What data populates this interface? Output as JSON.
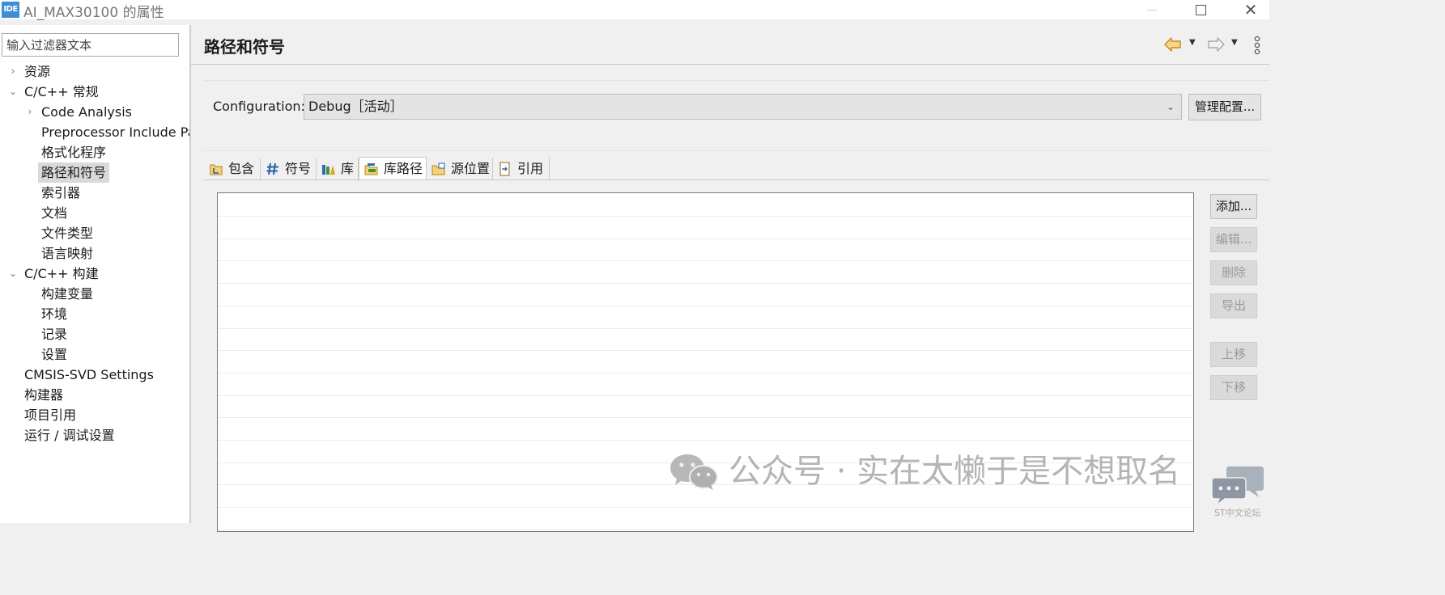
{
  "window": {
    "app_logo": "IDE",
    "title": "AI_MAX30100 的属性",
    "controls": [
      "minimize-icon",
      "maximize-icon",
      "close-icon"
    ]
  },
  "sidebar": {
    "filter_placeholder": "输入过滤器文本",
    "items": [
      {
        "label": "资源",
        "arrow": "›",
        "level": 0
      },
      {
        "label": "C/C++ 常规",
        "arrow": "⌄",
        "level": 0
      },
      {
        "label": "Code Analysis",
        "arrow": "›",
        "level": 1
      },
      {
        "label": "Preprocessor Include Pa",
        "arrow": "",
        "level": 1
      },
      {
        "label": "格式化程序",
        "arrow": "",
        "level": 1
      },
      {
        "label": "路径和符号",
        "arrow": "",
        "level": 1,
        "selected": true
      },
      {
        "label": "索引器",
        "arrow": "",
        "level": 1
      },
      {
        "label": "文档",
        "arrow": "",
        "level": 1
      },
      {
        "label": "文件类型",
        "arrow": "",
        "level": 1
      },
      {
        "label": "语言映射",
        "arrow": "",
        "level": 1
      },
      {
        "label": "C/C++ 构建",
        "arrow": "⌄",
        "level": 0
      },
      {
        "label": "构建变量",
        "arrow": "",
        "level": 1
      },
      {
        "label": "环境",
        "arrow": "",
        "level": 1
      },
      {
        "label": "记录",
        "arrow": "",
        "level": 1
      },
      {
        "label": "设置",
        "arrow": "",
        "level": 1
      },
      {
        "label": "CMSIS-SVD Settings",
        "arrow": "",
        "level": 0
      },
      {
        "label": "构建器",
        "arrow": "",
        "level": 0
      },
      {
        "label": "项目引用",
        "arrow": "",
        "level": 0
      },
      {
        "label": "运行 / 调试设置",
        "arrow": "",
        "level": 0
      }
    ]
  },
  "main": {
    "title": "路径和符号",
    "nav_icons": [
      "back-arrow-icon",
      "forward-arrow-icon",
      "more-icon"
    ],
    "configuration": {
      "label": "Configuration:",
      "value": "Debug［活动］",
      "manage_button": "管理配置..."
    },
    "tabs": [
      {
        "label": "包含",
        "icon": "include-icon"
      },
      {
        "label": "符号",
        "icon": "hash-icon"
      },
      {
        "label": "库",
        "icon": "library-icon"
      },
      {
        "label": "库路径",
        "icon": "library-path-icon",
        "active": true
      },
      {
        "label": "源位置",
        "icon": "source-folder-icon"
      },
      {
        "label": "引用",
        "icon": "reference-icon"
      }
    ],
    "buttons": {
      "add": "添加...",
      "edit": "编辑...",
      "delete": "删除",
      "export": "导出",
      "move_up": "上移",
      "move_down": "下移"
    }
  },
  "watermark": {
    "text": "公众号 · 实在太懒于是不想取名",
    "forum_label": "ST中文论坛"
  },
  "colors": {
    "accent": "#3b8fd6",
    "selected_bg": "#d9d9d9",
    "nav_back": "#e0a030"
  }
}
